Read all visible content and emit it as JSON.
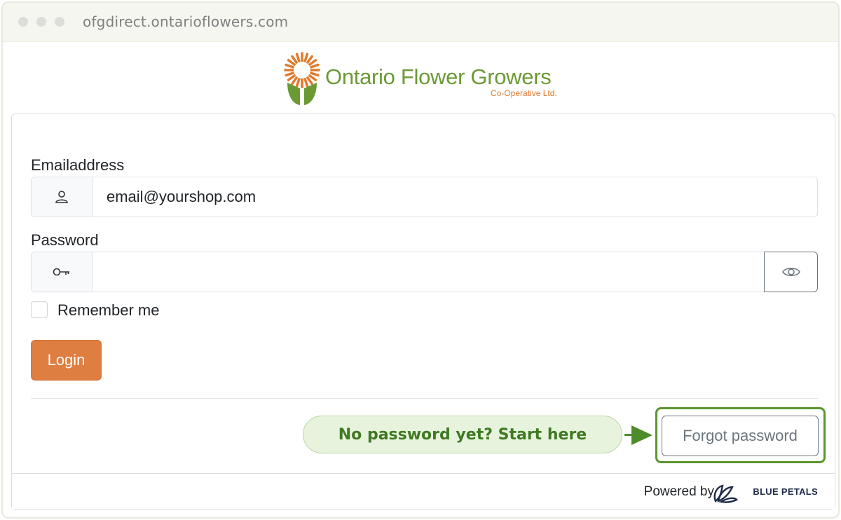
{
  "browser": {
    "url": "ofgdirect.ontarioflowers.com"
  },
  "brand": {
    "name": "Ontario Flower Growers",
    "subtitle": "Co-Operative Ltd.",
    "colors": {
      "green": "#6a9a34",
      "orange": "#e07a2d"
    }
  },
  "form": {
    "email_label": "Emailaddress",
    "email_value": "email@yourshop.com",
    "email_icon": "user-icon",
    "password_label": "Password",
    "password_value": "",
    "password_icon": "key-icon",
    "toggle_icon": "eye-icon",
    "remember_label": "Remember me",
    "remember_checked": false,
    "login_label": "Login",
    "login_color": "#df7e41"
  },
  "callout": {
    "text": "No password yet? Start here",
    "color": "#3f7a22"
  },
  "forgot_password_label": "Forgot password",
  "footer": {
    "powered_by": "Powered by",
    "vendor": "BLUE PETALS"
  }
}
